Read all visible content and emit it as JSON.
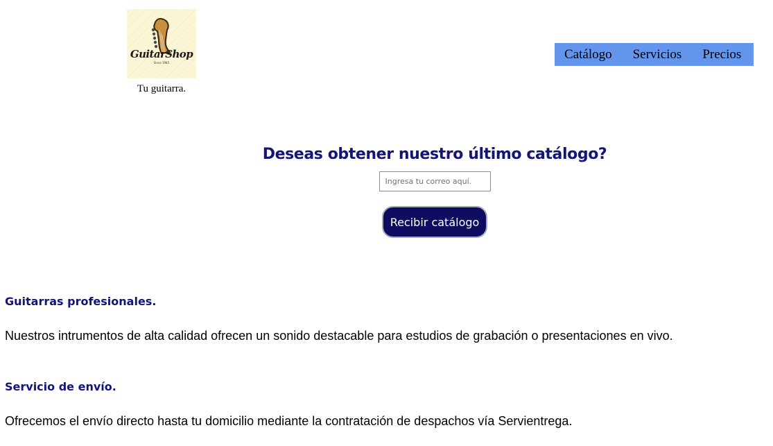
{
  "brand": {
    "logo_text": "GuitarShop",
    "logo_since": "Since 1985",
    "tagline": "Tu guitarra."
  },
  "nav": {
    "items": [
      "Catálogo",
      "Servicios",
      "Precios"
    ]
  },
  "subscribe": {
    "heading": "Deseas obtener nuestro último catálogo?",
    "email_placeholder": "Ingresa tu correo aquí.",
    "email_value": "",
    "button_label": "Recibir catálogo"
  },
  "sections": [
    {
      "title": "Guitarras profesionales.",
      "text": "Nuestros intrumentos de alta calidad ofrecen un sonido destacable para estudios de grabación o presentaciones en vivo."
    },
    {
      "title": "Servicio de envío.",
      "text": "Ofrecemos el envío directo hasta tu domicilio mediante la contratación de despachos vía Servientrega."
    }
  ],
  "colors": {
    "nav_background": "#6495ed",
    "heading": "#13137a",
    "button_background": "#0e0c5e",
    "logo_background": "#fbf6d5"
  }
}
